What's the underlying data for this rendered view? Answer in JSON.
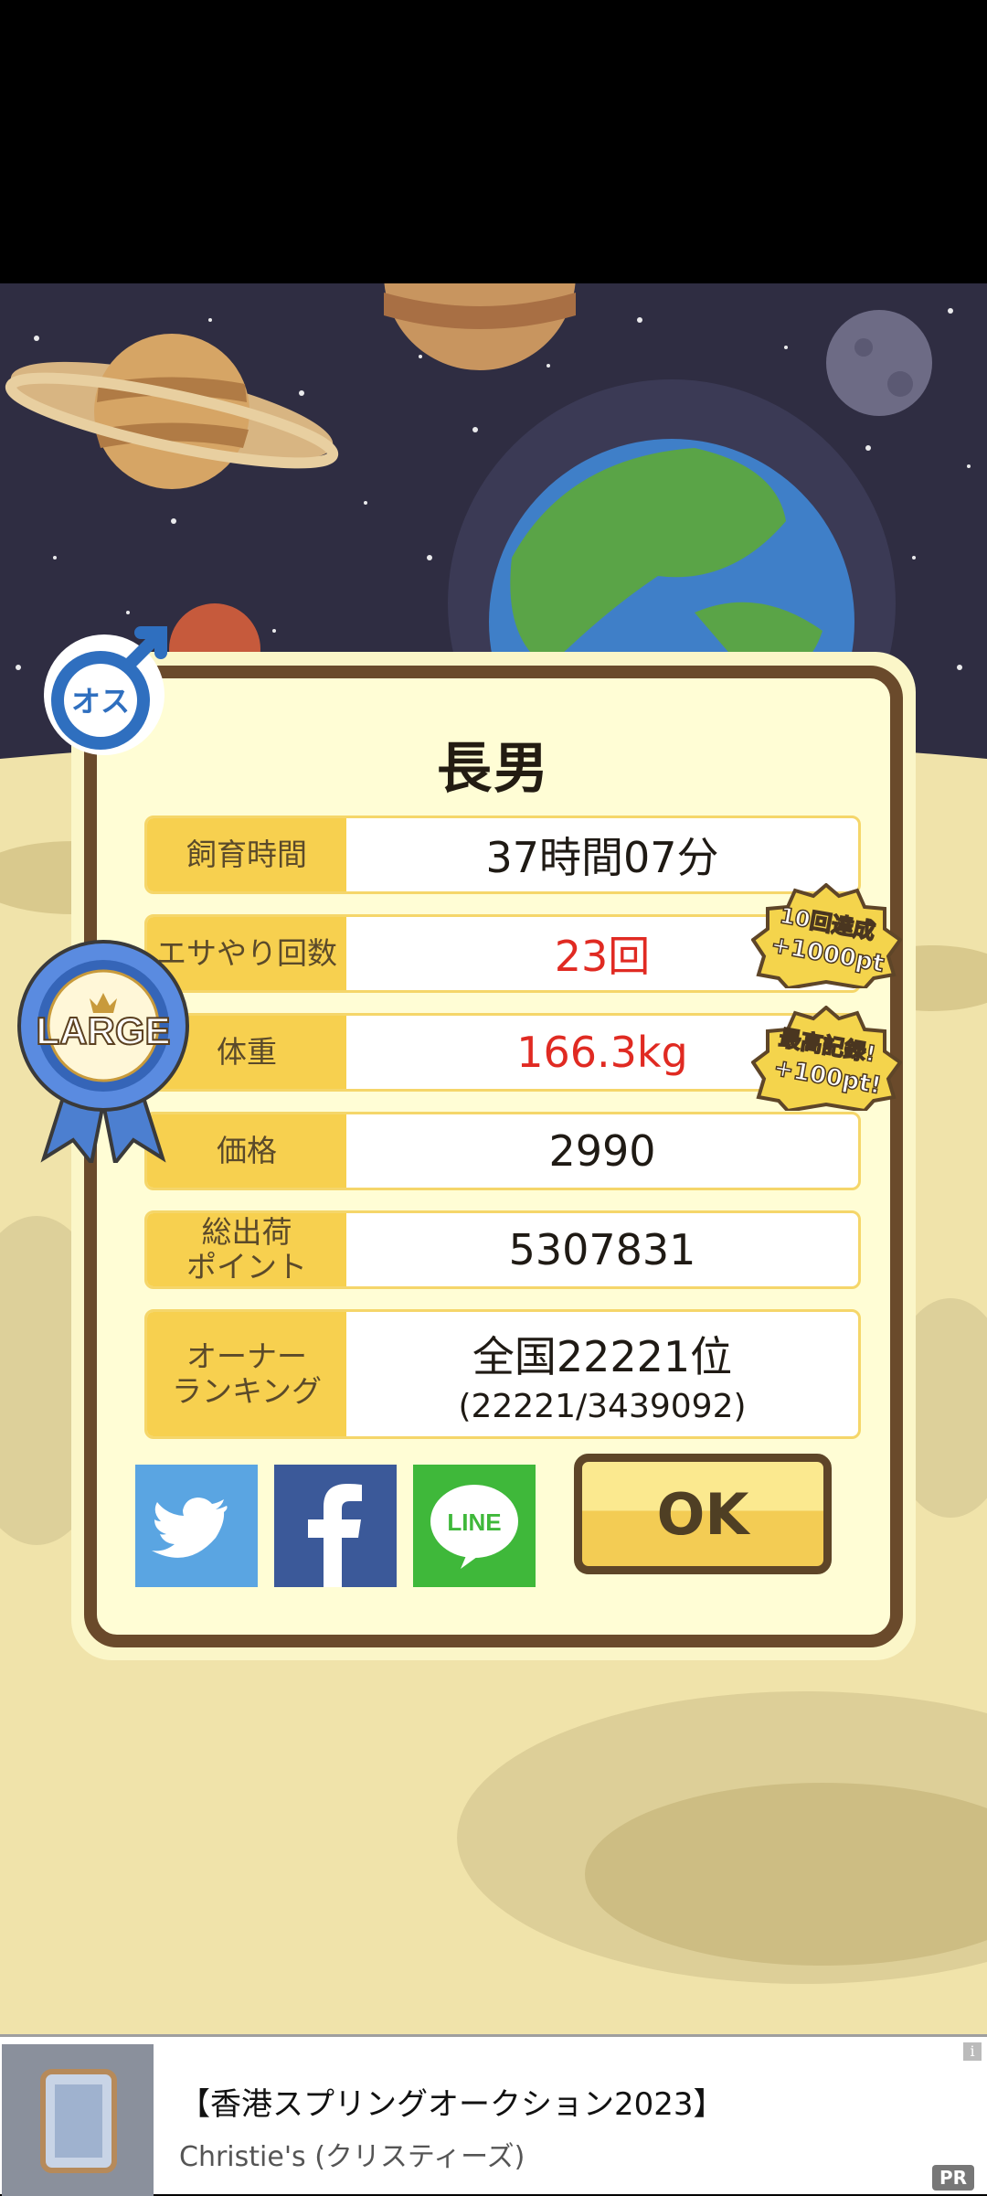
{
  "dialog": {
    "title": "長男",
    "gender": "オス",
    "rows": [
      {
        "label": "飼育時間",
        "value": "37時間07分"
      },
      {
        "label": "エサやり回数",
        "value": "23回"
      },
      {
        "label": "体重",
        "value": "166.3kg"
      },
      {
        "label": "価格",
        "value": "2990"
      },
      {
        "label": "総出荷\nポイント",
        "value": "5307831"
      },
      {
        "label": "オーナー\nランキング",
        "value": "全国22221位",
        "value_sub": "(22221/3439092)"
      }
    ],
    "size_ribbon": "LARGE",
    "badges": [
      {
        "line1": "10回達成",
        "line2": "+1000pt"
      },
      {
        "line1": "最高記録!",
        "line2": "+100pt!"
      }
    ],
    "share": {
      "twitter": "twitter-icon",
      "facebook": "facebook-icon",
      "line": "LINE"
    },
    "ok_label": "OK"
  },
  "ad": {
    "title": "【香港スプリングオークション2023】",
    "advertiser": "Christie's (クリスティーズ)",
    "pr": "PR",
    "info": "i"
  },
  "colors": {
    "accent": "#f7d04f",
    "frame": "#6a4a2b",
    "highlight": "#e02a22"
  }
}
